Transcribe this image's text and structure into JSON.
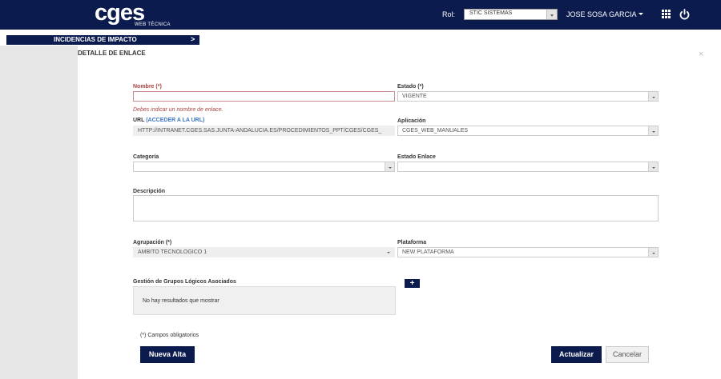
{
  "header": {
    "logo_text": "cges",
    "logo_sub": "WEB TÉCNICA",
    "rol_label": "Rol:",
    "rol_value": "STIC SISTEMAS",
    "user_name": "JOSE SOSA GARCIA",
    "brand_color": "#0b1b4e"
  },
  "nav": {
    "incidencias_label": "INCIDENCIAS DE IMPACTO",
    "chevron": ">"
  },
  "modal": {
    "title": "DETALLE DE ENLACE",
    "close": "×"
  },
  "form": {
    "nombre_label": "Nombre (*)",
    "nombre_value": "",
    "nombre_error": "Debes indicar un nombre de enlace.",
    "estado_label": "Estado (*)",
    "estado_value": "VIGENTE",
    "url_label": "URL",
    "url_link": "(ACCEDER A LA URL)",
    "url_value": "HTTP://INTRANET.CGES.SAS.JUNTA-ANDALUCIA.ES/PROCEDIMIENTOS_PPT/CGES/CGES_",
    "aplicacion_label": "Aplicación",
    "aplicacion_value": "CGES_WEB_MANUALES",
    "categoria_label": "Categoría",
    "categoria_value": "",
    "estado_enlace_label": "Estado Enlace",
    "estado_enlace_value": "",
    "descripcion_label": "Descripción",
    "agrupacion_label": "Agrupación (*)",
    "agrupacion_value": "AMBITO TECNOLOGICO 1",
    "plataforma_label": "Plataforma",
    "plataforma_value": "NEW PLATAFORMA",
    "grupos_label": "Gestión de Grupos Lógicos Asociados",
    "grupos_empty": "No hay resultados que mostrar",
    "add_label": "+",
    "obligatorios": "(*) Campos obligatorios"
  },
  "buttons": {
    "nueva_alta": "Nueva Alta",
    "actualizar": "Actualizar",
    "cancelar": "Cancelar"
  }
}
